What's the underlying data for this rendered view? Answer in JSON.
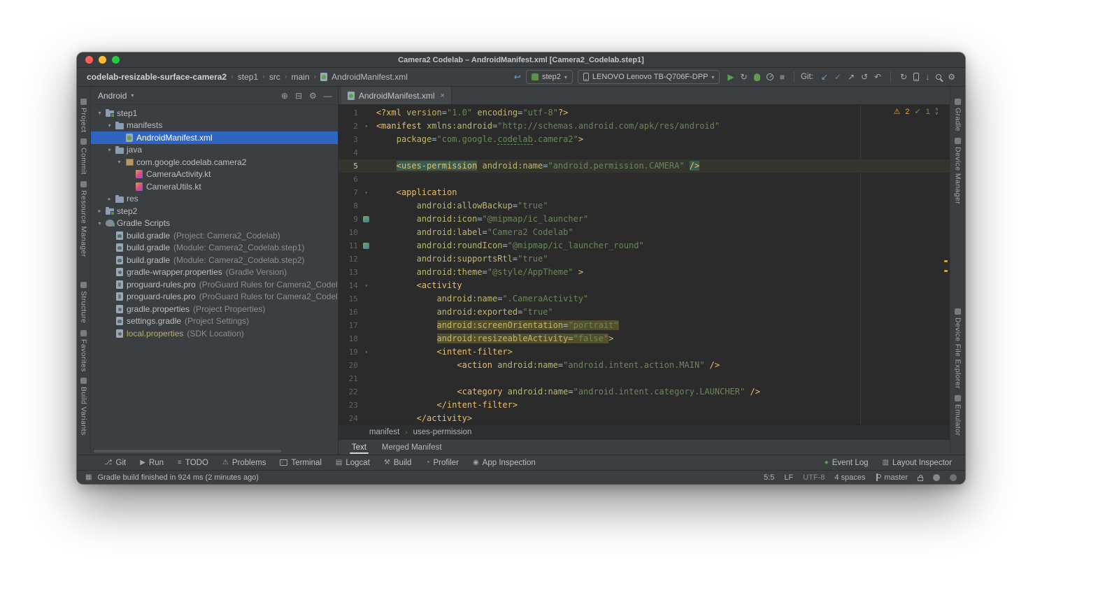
{
  "window": {
    "title": "Camera2 Codelab – AndroidManifest.xml [Camera2_Codelab.step1]"
  },
  "navbar": {
    "breadcrumbs": [
      "codelab-resizable-surface-camera2",
      "step1",
      "src",
      "main",
      "AndroidManifest.xml"
    ],
    "run_config": {
      "label": "step2"
    },
    "device": {
      "label": "LENOVO Lenovo TB-Q706F-DPP"
    },
    "git_label": "Git:",
    "toolbar": {
      "run_group": [
        "run",
        "apply-changes",
        "debug",
        "profiler",
        "stop"
      ],
      "git_group": [
        "update-project",
        "commit",
        "push",
        "history",
        "rollback"
      ],
      "tools_group": [
        "gradle-sync",
        "device-manager",
        "sdk-manager",
        "search",
        "settings"
      ]
    }
  },
  "tool_stripes": {
    "left_top": [
      "Project",
      "Commit",
      "Resource Manager"
    ],
    "left_bottom": [
      "Structure",
      "Favorites",
      "Build Variants"
    ],
    "right_top": [
      "Gradle",
      "Device Manager"
    ],
    "right_bottom": [
      "Device File Explorer",
      "Emulator"
    ]
  },
  "project_panel": {
    "view_selector": "Android",
    "tree": [
      {
        "label": "step1",
        "indent": 0,
        "chevron": "open",
        "icon": "module"
      },
      {
        "label": "manifests",
        "indent": 1,
        "chevron": "open",
        "icon": "folder"
      },
      {
        "label": "AndroidManifest.xml",
        "indent": 2,
        "chevron": "none",
        "icon": "manifest",
        "selected": true
      },
      {
        "label": "java",
        "indent": 1,
        "chevron": "open",
        "icon": "folder"
      },
      {
        "label": "com.google.codelab.camera2",
        "indent": 2,
        "chevron": "open",
        "icon": "package"
      },
      {
        "label": "CameraActivity.kt",
        "indent": 3,
        "chevron": "none",
        "icon": "kotlin"
      },
      {
        "label": "CameraUtils.kt",
        "indent": 3,
        "chevron": "none",
        "icon": "kotlin"
      },
      {
        "label": "res",
        "indent": 1,
        "chevron": "closed",
        "icon": "folder"
      },
      {
        "label": "step2",
        "indent": 0,
        "chevron": "closed",
        "icon": "module"
      },
      {
        "label": "Gradle Scripts",
        "indent": 0,
        "chevron": "open",
        "icon": "gradle-root"
      },
      {
        "label": "build.gradle",
        "note": "(Project: Camera2_Codelab)",
        "indent": 1,
        "chevron": "none",
        "icon": "gradle"
      },
      {
        "label": "build.gradle",
        "note": "(Module: Camera2_Codelab.step1)",
        "indent": 1,
        "chevron": "none",
        "icon": "gradle"
      },
      {
        "label": "build.gradle",
        "note": "(Module: Camera2_Codelab.step2)",
        "indent": 1,
        "chevron": "none",
        "icon": "gradle"
      },
      {
        "label": "gradle-wrapper.properties",
        "note": "(Gradle Version)",
        "indent": 1,
        "chevron": "none",
        "icon": "props"
      },
      {
        "label": "proguard-rules.pro",
        "note": "(ProGuard Rules for Camera2_Codel",
        "indent": 1,
        "chevron": "none",
        "icon": "pro"
      },
      {
        "label": "proguard-rules.pro",
        "note": "(ProGuard Rules for Camera2_Codel",
        "indent": 1,
        "chevron": "none",
        "icon": "pro"
      },
      {
        "label": "gradle.properties",
        "note": "(Project Properties)",
        "indent": 1,
        "chevron": "none",
        "icon": "props"
      },
      {
        "label": "settings.gradle",
        "note": "(Project Settings)",
        "indent": 1,
        "chevron": "none",
        "icon": "gradle"
      },
      {
        "label": "local.properties",
        "note": "(SDK Location)",
        "indent": 1,
        "chevron": "none",
        "icon": "props",
        "muted": true
      }
    ]
  },
  "editor": {
    "tab": {
      "label": "AndroidManifest.xml"
    },
    "inspections": {
      "warnings": "2",
      "passed": "1"
    },
    "breadcrumbs": [
      "manifest",
      "uses-permission"
    ],
    "view_tabs": [
      {
        "label": "Text",
        "active": true
      },
      {
        "label": "Merged Manifest",
        "active": false
      }
    ],
    "lines": [
      {
        "n": 1,
        "seg": [
          [
            "<?xml ",
            "t"
          ],
          [
            "version",
            "a"
          ],
          [
            "=",
            "p"
          ],
          [
            "\"1.0\"",
            "v"
          ],
          [
            " ",
            "p"
          ],
          [
            "encoding",
            "a"
          ],
          [
            "=",
            "p"
          ],
          [
            "\"utf-8\"",
            "v"
          ],
          [
            "?>",
            "t"
          ]
        ]
      },
      {
        "n": 2,
        "fold": true,
        "seg": [
          [
            "<manifest ",
            "t"
          ],
          [
            "xmlns:android",
            "a"
          ],
          [
            "=",
            "p"
          ],
          [
            "\"http://schemas.android.com/apk/res/android\"",
            "v"
          ]
        ]
      },
      {
        "n": 3,
        "seg": [
          [
            "    ",
            "p"
          ],
          [
            "package",
            "a"
          ],
          [
            "=",
            "p"
          ],
          [
            "\"com.google.",
            "v"
          ],
          [
            "codelab",
            "v ty"
          ],
          [
            ".camera2\"",
            "v"
          ],
          [
            ">",
            "t"
          ]
        ]
      },
      {
        "n": 4,
        "seg": []
      },
      {
        "n": 5,
        "caret": true,
        "seg": [
          [
            "    ",
            "p"
          ],
          [
            "<uses-permission",
            "t ht"
          ],
          [
            " ",
            "p"
          ],
          [
            "android:name",
            "a"
          ],
          [
            "=",
            "p"
          ],
          [
            "\"android.permission.CAMERA\"",
            "v"
          ],
          [
            " ",
            "p"
          ],
          [
            "/>",
            "t ht"
          ]
        ]
      },
      {
        "n": 6,
        "seg": []
      },
      {
        "n": 7,
        "fold": true,
        "seg": [
          [
            "    ",
            "p"
          ],
          [
            "<application",
            "t"
          ]
        ]
      },
      {
        "n": 8,
        "seg": [
          [
            "        ",
            "p"
          ],
          [
            "android:allowBackup",
            "a"
          ],
          [
            "=",
            "p"
          ],
          [
            "\"true\"",
            "v"
          ]
        ]
      },
      {
        "n": 9,
        "img": true,
        "seg": [
          [
            "        ",
            "p"
          ],
          [
            "android:icon",
            "a"
          ],
          [
            "=",
            "p"
          ],
          [
            "\"@mipmap/ic_launcher\"",
            "v"
          ]
        ]
      },
      {
        "n": 10,
        "seg": [
          [
            "        ",
            "p"
          ],
          [
            "android:label",
            "a"
          ],
          [
            "=",
            "p"
          ],
          [
            "\"Camera2 Codelab\"",
            "v"
          ]
        ]
      },
      {
        "n": 11,
        "img": true,
        "seg": [
          [
            "        ",
            "p"
          ],
          [
            "android:roundIcon",
            "a"
          ],
          [
            "=",
            "p"
          ],
          [
            "\"@mipmap/ic_launcher_round\"",
            "v"
          ]
        ]
      },
      {
        "n": 12,
        "seg": [
          [
            "        ",
            "p"
          ],
          [
            "android:supportsRtl",
            "a"
          ],
          [
            "=",
            "p"
          ],
          [
            "\"true\"",
            "v"
          ]
        ]
      },
      {
        "n": 13,
        "seg": [
          [
            "        ",
            "p"
          ],
          [
            "android:theme",
            "a"
          ],
          [
            "=",
            "p"
          ],
          [
            "\"@style/AppTheme\"",
            "v"
          ],
          [
            " >",
            "t"
          ]
        ]
      },
      {
        "n": 14,
        "fold": true,
        "seg": [
          [
            "        ",
            "p"
          ],
          [
            "<activity",
            "t"
          ]
        ]
      },
      {
        "n": 15,
        "seg": [
          [
            "            ",
            "p"
          ],
          [
            "android:name",
            "a"
          ],
          [
            "=",
            "p"
          ],
          [
            "\".CameraActivity\"",
            "v"
          ]
        ]
      },
      {
        "n": 16,
        "seg": [
          [
            "            ",
            "p"
          ],
          [
            "android:exported",
            "a"
          ],
          [
            "=",
            "p"
          ],
          [
            "\"true\"",
            "v"
          ]
        ]
      },
      {
        "n": 17,
        "seg": [
          [
            "            ",
            "p"
          ],
          [
            "android:screenOrientation",
            "a hy"
          ],
          [
            "=",
            "p hy"
          ],
          [
            "\"portrait\"",
            "v hy"
          ]
        ]
      },
      {
        "n": 18,
        "seg": [
          [
            "            ",
            "p"
          ],
          [
            "android:resizeableActivity",
            "a hy"
          ],
          [
            "=",
            "p hy"
          ],
          [
            "\"false\"",
            "v hy"
          ],
          [
            ">",
            "t"
          ]
        ]
      },
      {
        "n": 19,
        "fold": true,
        "seg": [
          [
            "            ",
            "p"
          ],
          [
            "<intent-filter>",
            "t"
          ]
        ]
      },
      {
        "n": 20,
        "seg": [
          [
            "                ",
            "p"
          ],
          [
            "<action ",
            "t"
          ],
          [
            "android:name",
            "a"
          ],
          [
            "=",
            "p"
          ],
          [
            "\"android.intent.action.MAIN\"",
            "v"
          ],
          [
            " ",
            "p"
          ],
          [
            "/>",
            "t"
          ]
        ]
      },
      {
        "n": 21,
        "seg": []
      },
      {
        "n": 22,
        "seg": [
          [
            "                ",
            "p"
          ],
          [
            "<category ",
            "t"
          ],
          [
            "android:name",
            "a"
          ],
          [
            "=",
            "p"
          ],
          [
            "\"android.intent.category.LAUNCHER\"",
            "v"
          ],
          [
            " ",
            "p"
          ],
          [
            "/>",
            "t"
          ]
        ]
      },
      {
        "n": 23,
        "seg": [
          [
            "            ",
            "p"
          ],
          [
            "</intent-filter>",
            "t"
          ]
        ]
      },
      {
        "n": 24,
        "seg": [
          [
            "        ",
            "p"
          ],
          [
            "</activity>",
            "t"
          ]
        ]
      }
    ]
  },
  "bottom_bar": {
    "left": [
      {
        "label": "Git",
        "icon": "git"
      },
      {
        "label": "Run",
        "icon": "run"
      },
      {
        "label": "TODO",
        "icon": "todo"
      },
      {
        "label": "Problems",
        "icon": "problems"
      },
      {
        "label": "Terminal",
        "icon": "terminal"
      },
      {
        "label": "Logcat",
        "icon": "logcat"
      },
      {
        "label": "Build",
        "icon": "build"
      },
      {
        "label": "Profiler",
        "icon": "profiler"
      },
      {
        "label": "App Inspection",
        "icon": "app-inspection"
      }
    ],
    "right": [
      {
        "label": "Event Log",
        "icon": "event-log"
      },
      {
        "label": "Layout Inspector",
        "icon": "layout-inspector"
      }
    ]
  },
  "status_bar": {
    "message": "Gradle build finished in 924 ms (2 minutes ago)",
    "caret_position": "5:5",
    "line_separator": "LF",
    "encoding": "UTF-8",
    "indent": "4 spaces",
    "branch": "master"
  },
  "colors": {
    "selection_blue": "#2f65c0",
    "run_green": "#5a9e53",
    "warning_yellow": "#e2a53a",
    "xml_tag": "#e8bf6a",
    "xml_attribute": "#bdb76b",
    "xml_string": "#6a8759"
  }
}
